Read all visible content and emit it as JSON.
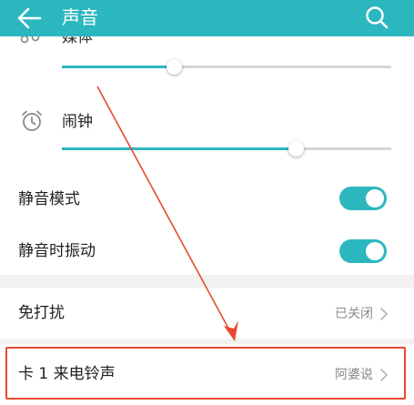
{
  "header": {
    "title": "声音"
  },
  "media": {
    "label": "媒体",
    "level": 0.34
  },
  "alarm": {
    "label": "闹钟",
    "level": 0.71
  },
  "silent_mode": {
    "label": "静音模式",
    "on": true
  },
  "vibrate_silent": {
    "label": "静音时振动",
    "on": true
  },
  "dnd": {
    "label": "免打扰",
    "value": "已关闭"
  },
  "ringtone": {
    "label": "卡 1 来电铃声",
    "value": "阿婆说"
  },
  "colors": {
    "accent": "#2cb7bf",
    "annotation": "#e8492f"
  },
  "icons": {
    "back": "back-arrow-icon",
    "search": "search-icon",
    "media": "music-note-icon",
    "alarm": "alarm-clock-icon",
    "chevron": "chevron-right-icon"
  }
}
